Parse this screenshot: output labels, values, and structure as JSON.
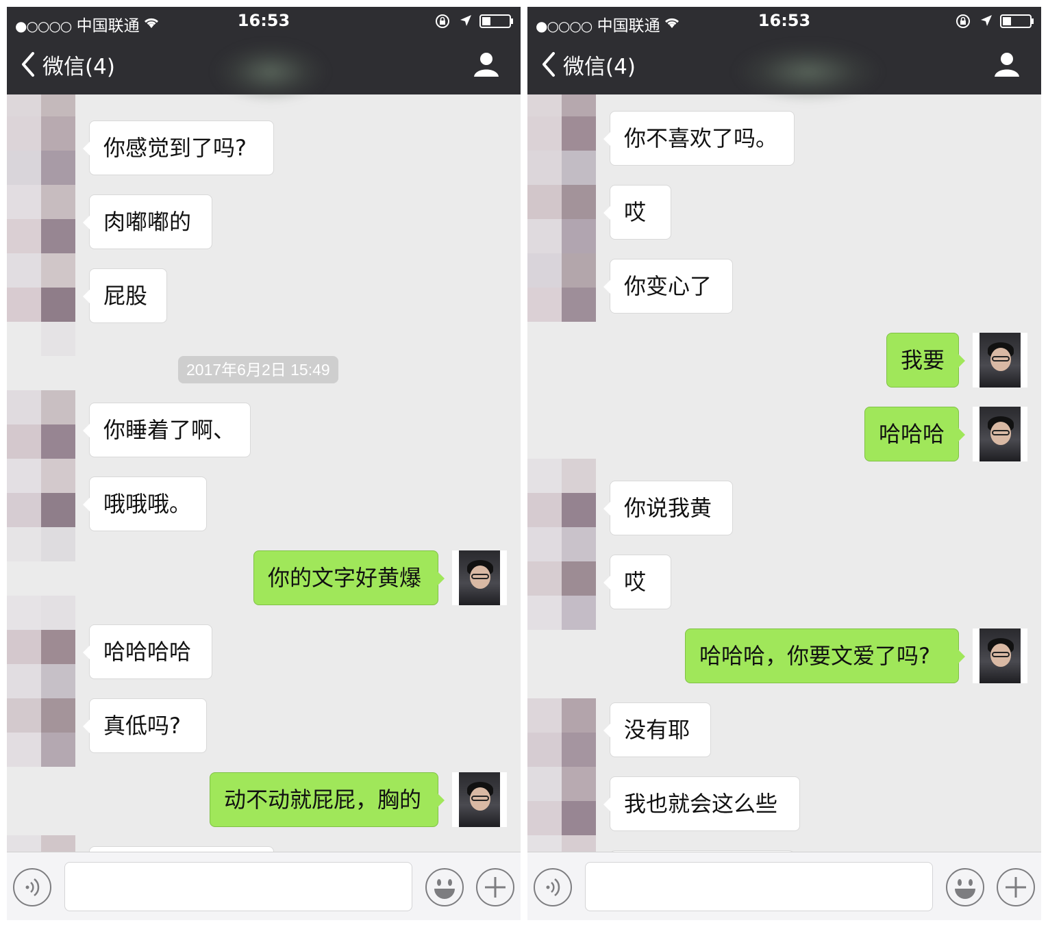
{
  "status_bar": {
    "signal": "●○○○○",
    "carrier": "中国联通",
    "time": "16:53"
  },
  "nav": {
    "back_label": "微信(4)"
  },
  "colors": {
    "bar_bg": "#2e2e32",
    "chat_bg": "#ebebeb",
    "incoming_bubble": "#ffffff",
    "outgoing_bubble": "#a0e75a"
  },
  "left_screen": {
    "messages": [
      {
        "from": "them",
        "text": "你感觉到了吗?"
      },
      {
        "from": "them",
        "text": "肉嘟嘟的"
      },
      {
        "from": "them",
        "text": "屁股"
      },
      {
        "type": "timestamp",
        "text": "2017年6月2日 15:49"
      },
      {
        "from": "them",
        "text": "你睡着了啊、"
      },
      {
        "from": "them",
        "text": "哦哦哦。"
      },
      {
        "from": "me",
        "text": "你的文字好黄爆"
      },
      {
        "from": "them",
        "text": "哈哈哈哈"
      },
      {
        "from": "them",
        "text": "真低吗?"
      },
      {
        "from": "me",
        "text": "动不动就屁屁，胸的"
      }
    ]
  },
  "right_screen": {
    "messages": [
      {
        "from": "them",
        "text": "你不喜欢了吗。"
      },
      {
        "from": "them",
        "text": "哎"
      },
      {
        "from": "them",
        "text": "你变心了"
      },
      {
        "from": "me",
        "text": "我要"
      },
      {
        "from": "me",
        "text": "哈哈哈"
      },
      {
        "from": "them",
        "text": "你说我黄"
      },
      {
        "from": "them",
        "text": "哎"
      },
      {
        "from": "me",
        "text": "哈哈哈，你要文爱了吗?"
      },
      {
        "from": "them",
        "text": "没有耶"
      },
      {
        "from": "them",
        "text": "我也就会这么些"
      }
    ]
  },
  "icons": {
    "back": "chevron-left-icon",
    "profile": "person-icon",
    "voice": "voice-icon",
    "emoji": "emoji-icon",
    "plus": "plus-icon",
    "wifi": "wifi-icon",
    "lock": "rotation-lock-icon",
    "location": "location-arrow-icon",
    "battery": "battery-icon"
  }
}
